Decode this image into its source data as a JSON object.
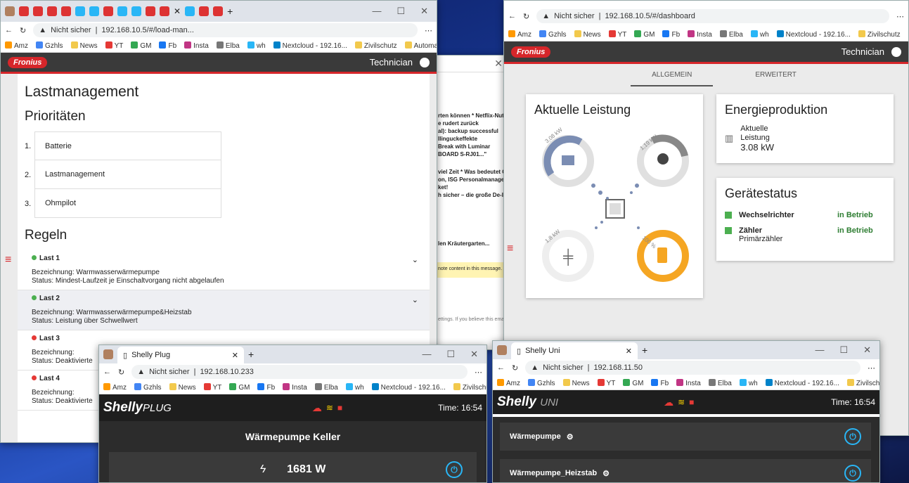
{
  "left": {
    "tab_title": "Lastmanagement",
    "url": "192.168.10.5/#/load-man...",
    "security": "Nicht sicher",
    "bookmarks": [
      "Amz",
      "Gzhls",
      "News",
      "YT",
      "GM",
      "Fb",
      "Insta",
      "Elba",
      "wh",
      "Nextcloud - 192.16...",
      "Zivilschutz",
      "Automation"
    ],
    "user": "Technician",
    "logo": "Fronius",
    "page_title": "Lastmanagement",
    "prio_title": "Prioritäten",
    "priorities": [
      {
        "num": "1.",
        "label": "Batterie"
      },
      {
        "num": "2.",
        "label": "Lastmanagement"
      },
      {
        "num": "3.",
        "label": "Ohmpilot"
      }
    ],
    "rules_title": "Regeln",
    "rules": [
      {
        "name": "Last 1",
        "status_color": "#4caf50",
        "desc": "Bezeichnung: Warmwasserwärmepumpe",
        "status": "Status: Mindest-Laufzeit je Einschaltvorgang nicht abgelaufen"
      },
      {
        "name": "Last 2",
        "status_color": "#4caf50",
        "desc": "Bezeichnung: Warmwasserwärmepumpe&Heizstab",
        "status": "Status: Leistung über Schwellwert"
      },
      {
        "name": "Last 3",
        "status_color": "#e53935",
        "desc": "Bezeichnung:",
        "status": "Status: Deaktivierte"
      },
      {
        "name": "Last 4",
        "status_color": "#e53935",
        "desc": "Bezeichnung:",
        "status": "Status: Deaktivierte"
      }
    ]
  },
  "mail": {
    "lines": [
      "rten können * Netflix-Nutze",
      "e rudert zurück",
      "al): backup successful",
      "llinguckeffekte",
      "Break with Luminar",
      "BOARD S-RJ01...\"",
      "viel Zeit * Was bedeutet Cat",
      "on, ISG Personalmanageme",
      "ket!",
      "h sicher – die große De-Indu",
      "len Kräutergarten..."
    ],
    "banner": "note content in this message.",
    "footer": "ettings. If you believe this email"
  },
  "right": {
    "url": "192.168.10.5/#/dashboard",
    "security": "Nicht sicher",
    "bookmarks": [
      "Amz",
      "Gzhls",
      "News",
      "YT",
      "GM",
      "Fb",
      "Insta",
      "Elba",
      "wh",
      "Nextcloud - 192.16...",
      "Zivilschutz"
    ],
    "user": "Technician",
    "logo": "Fronius",
    "tabs": [
      "ALLGEMEIN",
      "ERWEITERT"
    ],
    "leistung_title": "Aktuelle Leistung",
    "pv_label": "3,08 kW",
    "load_label": "1,19 kW",
    "grid_label": "1,8 kW",
    "battery_label": "100 %",
    "energy_title": "Energieproduktion",
    "energy_label1": "Aktuelle",
    "energy_label2": "Leistung",
    "energy_value": "3.08 kW",
    "status_title": "Gerätestatus",
    "devices": [
      {
        "name": "Wechselrichter",
        "state": "in Betrieb",
        "sub": ""
      },
      {
        "name": "Zähler",
        "state": "in Betrieb",
        "sub": "Primärzähler"
      }
    ],
    "state_color": "#2e7d32"
  },
  "plug": {
    "tab_title": "Shelly Plug",
    "url": "192.168.10.233",
    "security": "Nicht sicher",
    "bookmarks": [
      "Amz",
      "Gzhls",
      "News",
      "YT",
      "GM",
      "Fb",
      "Insta",
      "Elba",
      "wh",
      "Nextcloud - 192.16...",
      "Zivilschutz"
    ],
    "logo_a": "Shelly",
    "logo_b": "PLUG",
    "time": "Time: 16:54",
    "device": "Wärmepumpe Keller",
    "power": "1681 W"
  },
  "uni": {
    "tab_title": "Shelly Uni",
    "url": "192.168.11.50",
    "security": "Nicht sicher",
    "bookmarks": [
      "Amz",
      "Gzhls",
      "News",
      "YT",
      "GM",
      "Fb",
      "Insta",
      "Elba",
      "wh",
      "Nextcloud - 192.16...",
      "Zivilschutz"
    ],
    "logo_a": "Shelly",
    "logo_b": "UNI",
    "time": "Time: 16:54",
    "channels": [
      "Wärmepumpe",
      "Wärmepumpe_Heizstab"
    ]
  },
  "colors": {
    "fronius_red": "#d6262a",
    "solar": "#7b8db3",
    "battery": "#f5a623",
    "shelly_blue": "#29b6f6",
    "cloud_red": "#e53935",
    "wifi": "#ffd600"
  }
}
